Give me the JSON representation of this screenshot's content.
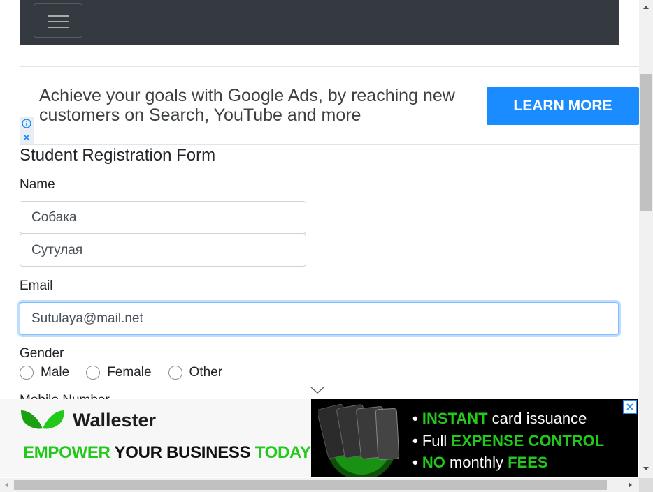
{
  "navbar": {
    "toggle_icon": "hamburger-icon"
  },
  "ad_top": {
    "text": "Achieve your goals with Google Ads, by reaching new customers on Search, YouTube and more",
    "cta": "LEARN MORE",
    "info_icon": "info-icon",
    "close_icon": "close-icon"
  },
  "form": {
    "title": "Student Registration Form",
    "name_label": "Name",
    "first_name": "Собака",
    "last_name": "Сутулая",
    "email_label": "Email",
    "email": "Sutulaya@mail.net",
    "gender_label": "Gender",
    "gender_options": [
      "Male",
      "Female",
      "Other"
    ],
    "next_label_partial": "Mobile Number"
  },
  "ad_bottom": {
    "brand": "Wallester",
    "slogan_1": "EMPOWER",
    "slogan_2": "YOUR BUSINESS",
    "slogan_3": "TODAY",
    "bullet_1_a": "INSTANT",
    "bullet_1_b": "card issuance",
    "bullet_2_a": "Full",
    "bullet_2_b": "EXPENSE CONTROL",
    "bullet_3_a": "NO",
    "bullet_3_b": "monthly",
    "bullet_3_c": "FEES"
  },
  "colors": {
    "navbar": "#343a40",
    "ad_cta": "#1a8cff",
    "wallester_green": "#22c91a",
    "focus_border": "#80bdff"
  }
}
